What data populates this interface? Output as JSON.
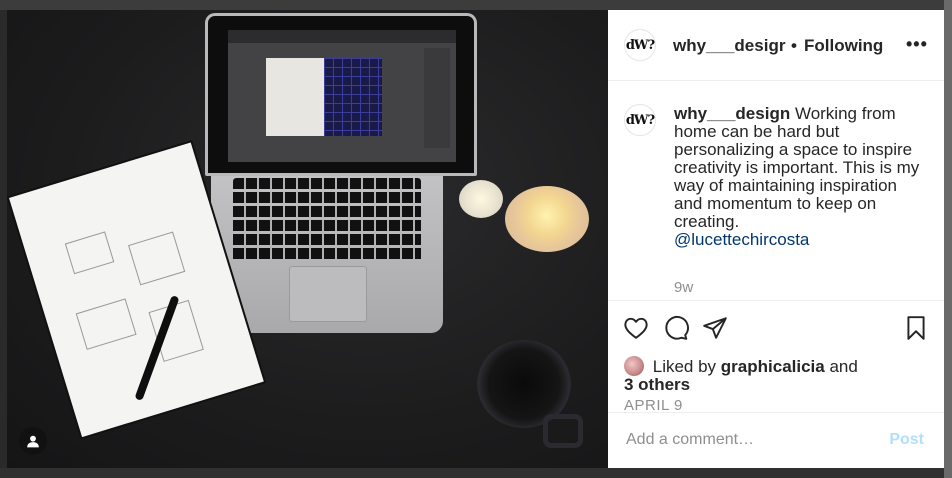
{
  "post": {
    "author": "why___design",
    "author_short": "why___desigr",
    "follow_separator": "•",
    "follow_label": "Following",
    "more_label": "•••",
    "avatar_text": "dW?",
    "caption_text": "Working from home can be hard but personalizing a space to inspire creativity is important. This is my way of maintaining inspiration and momentum to keep on creating.",
    "mention": "@lucettechircosta",
    "time_ago": "9w",
    "likes_prefix": "Liked by",
    "likes_user": "graphicalicia",
    "likes_and": "and",
    "likes_others": "3 others",
    "date": "APRIL 9"
  },
  "comment": {
    "placeholder": "Add a comment…",
    "post_label": "Post"
  },
  "icons": {
    "like": "heart-icon",
    "comment": "comment-icon",
    "share": "paper-plane-icon",
    "save": "bookmark-icon",
    "user_tag": "user-icon"
  },
  "colors": {
    "mention": "#00376b",
    "post_disabled": "#b2dffc",
    "muted": "#8e8e8e"
  }
}
